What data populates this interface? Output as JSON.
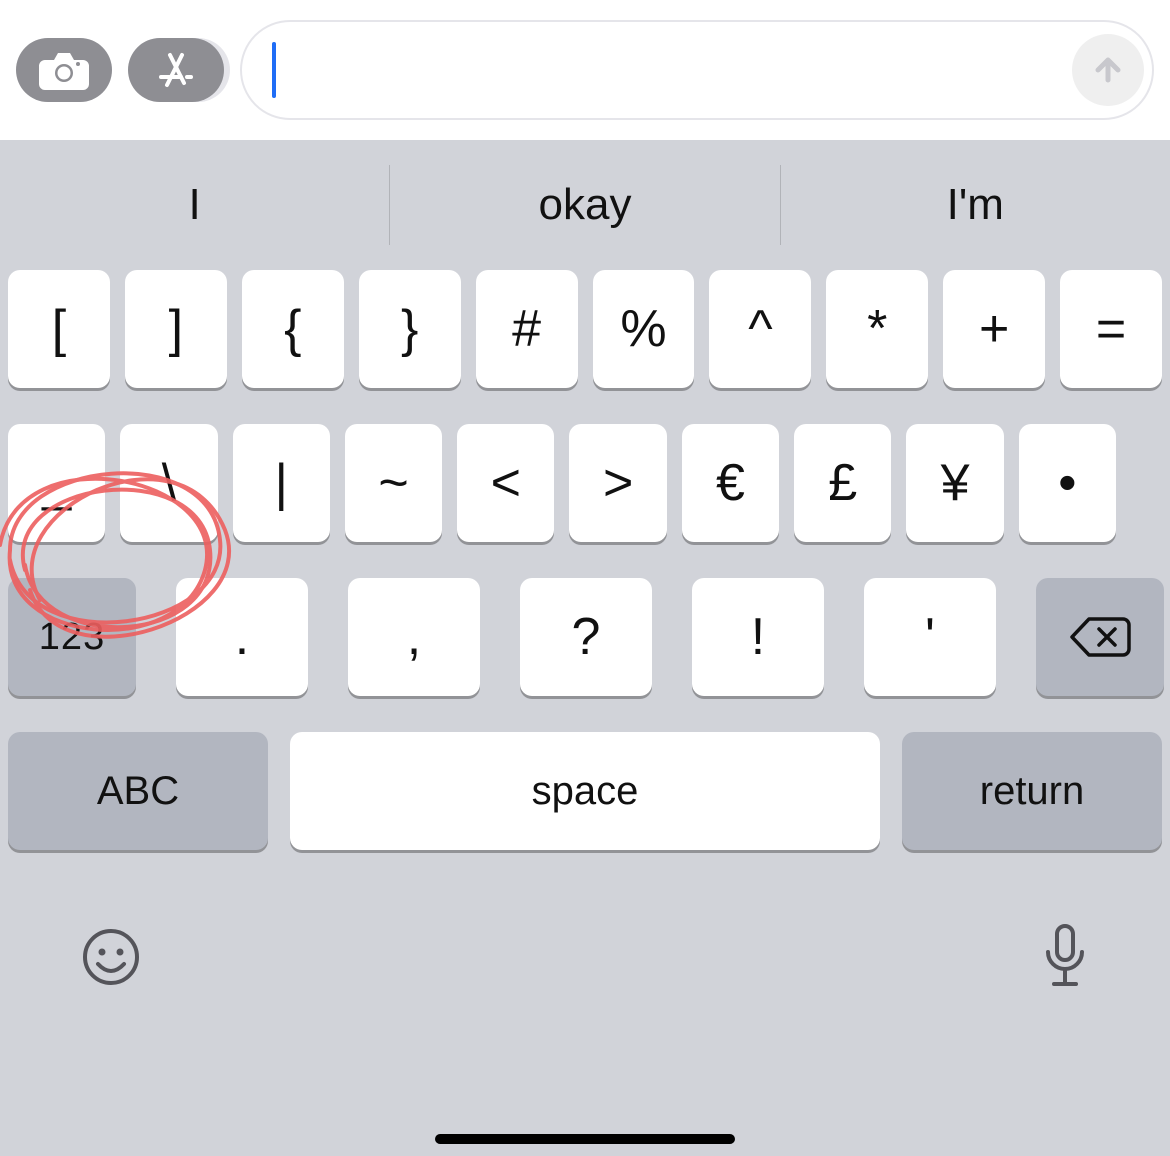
{
  "input": {
    "message_value": "",
    "message_placeholder": ""
  },
  "suggestions": [
    "I",
    "okay",
    "I'm"
  ],
  "rows": {
    "r1": [
      "[",
      "]",
      "{",
      "}",
      "#",
      "%",
      "^",
      "*",
      "+",
      "="
    ],
    "r2": [
      "_",
      "\\",
      "|",
      "~",
      "<",
      ">",
      "€",
      "£",
      "¥",
      "•"
    ],
    "r3_mode": "123",
    "r3_chars": [
      ".",
      ",",
      "?",
      "!",
      "'"
    ],
    "abc": "ABC",
    "space": "space",
    "return": "return"
  },
  "icons": {
    "camera": "camera-icon",
    "apps": "app-store-icon",
    "send": "arrow-up-icon",
    "backspace": "backspace-icon",
    "emoji": "emoji-icon",
    "mic": "microphone-icon"
  },
  "colors": {
    "key_bg": "#ffffff",
    "gray_key_bg": "#b2b6c0",
    "keyboard_bg": "#d1d3d9",
    "cursor": "#1f6df6",
    "annotation": "#ed5f5f"
  }
}
